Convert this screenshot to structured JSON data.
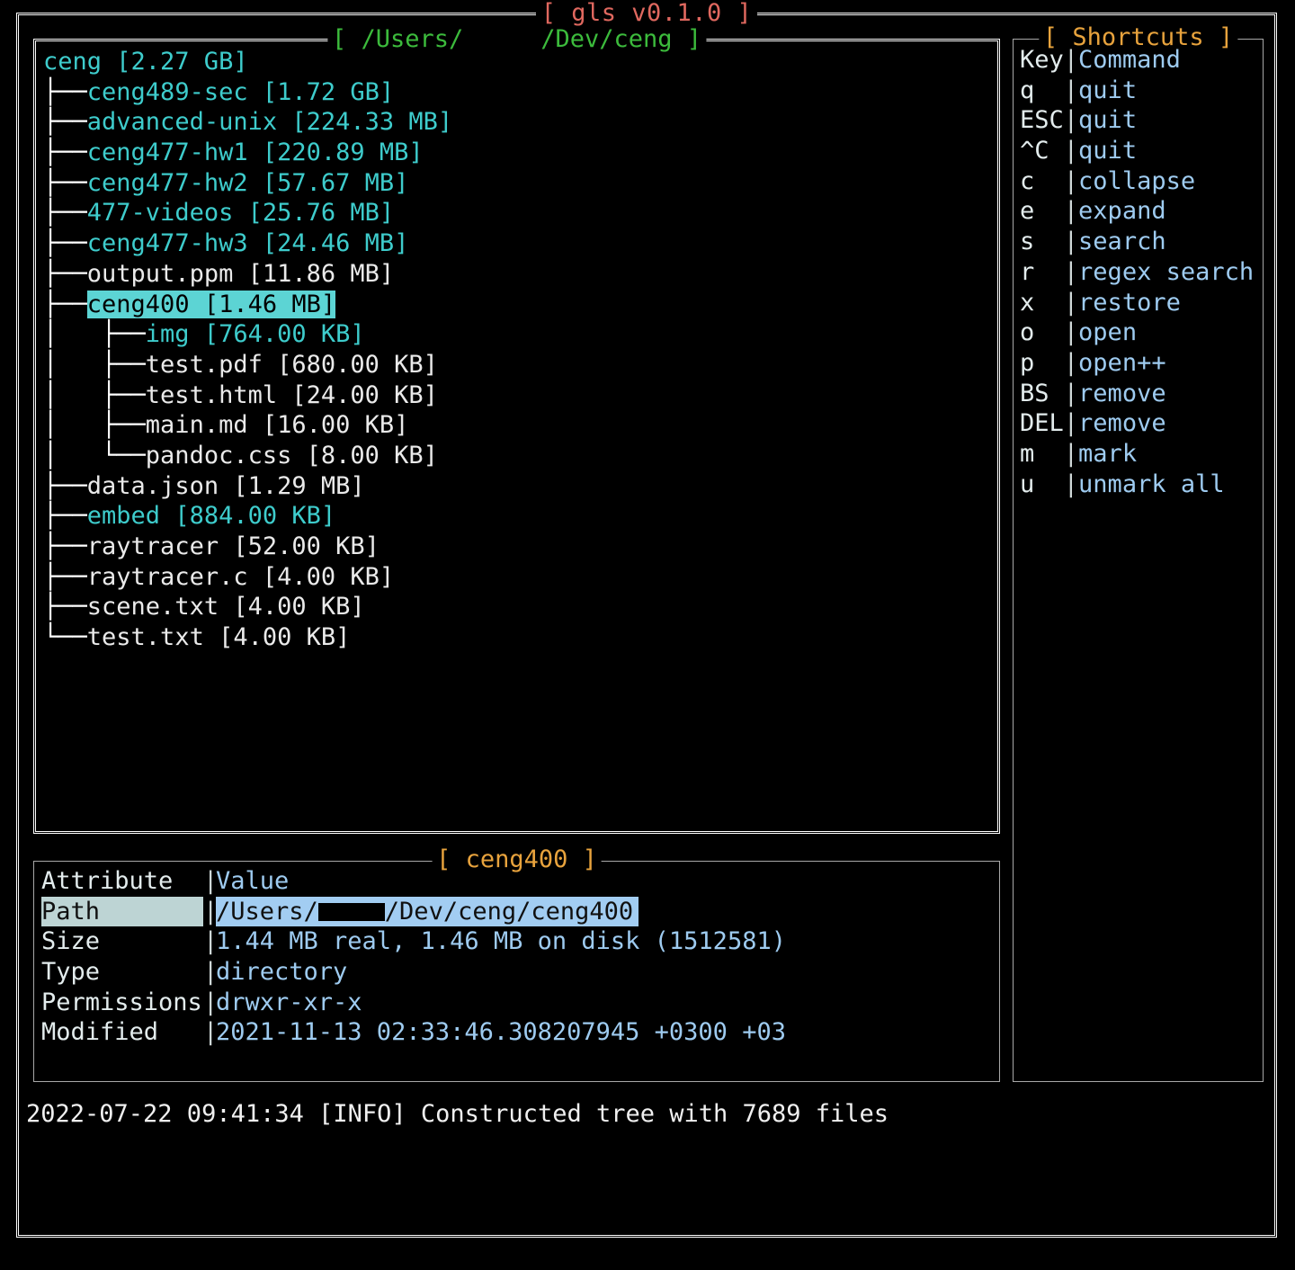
{
  "window": {
    "title": "[ gls v0.1.0 ]",
    "title_color": "#e0685f"
  },
  "tree_panel": {
    "title": "[ /Users/      /Dev/ceng ]",
    "title_prefix": "[ /Users/",
    "title_suffix": "/Dev/ceng ]",
    "title_color": "#3cbb3c",
    "focused": true,
    "rows": [
      {
        "connector": "",
        "name": "ceng",
        "size": "[2.27 GB]",
        "kind": "dir",
        "selected": false
      },
      {
        "connector": "├──",
        "name": "ceng489-sec",
        "size": "[1.72 GB]",
        "kind": "dir",
        "selected": false
      },
      {
        "connector": "├──",
        "name": "advanced-unix",
        "size": "[224.33 MB]",
        "kind": "dir",
        "selected": false
      },
      {
        "connector": "├──",
        "name": "ceng477-hw1",
        "size": "[220.89 MB]",
        "kind": "dir",
        "selected": false
      },
      {
        "connector": "├──",
        "name": "ceng477-hw2",
        "size": "[57.67 MB]",
        "kind": "dir",
        "selected": false
      },
      {
        "connector": "├──",
        "name": "477-videos",
        "size": "[25.76 MB]",
        "kind": "dir",
        "selected": false
      },
      {
        "connector": "├──",
        "name": "ceng477-hw3",
        "size": "[24.46 MB]",
        "kind": "dir",
        "selected": false
      },
      {
        "connector": "├──",
        "name": "output.ppm",
        "size": "[11.86 MB]",
        "kind": "file",
        "selected": false
      },
      {
        "connector": "├──",
        "name": "ceng400",
        "size": "[1.46 MB]",
        "kind": "dir",
        "selected": true
      },
      {
        "connector": "│   ├──",
        "name": "img",
        "size": "[764.00 KB]",
        "kind": "dir",
        "selected": false
      },
      {
        "connector": "│   ├──",
        "name": "test.pdf",
        "size": "[680.00 KB]",
        "kind": "file",
        "selected": false
      },
      {
        "connector": "│   ├──",
        "name": "test.html",
        "size": "[24.00 KB]",
        "kind": "file",
        "selected": false
      },
      {
        "connector": "│   ├──",
        "name": "main.md",
        "size": "[16.00 KB]",
        "kind": "file",
        "selected": false
      },
      {
        "connector": "│   └──",
        "name": "pandoc.css",
        "size": "[8.00 KB]",
        "kind": "file",
        "selected": false
      },
      {
        "connector": "├──",
        "name": "data.json",
        "size": "[1.29 MB]",
        "kind": "file",
        "selected": false
      },
      {
        "connector": "├──",
        "name": "embed",
        "size": "[884.00 KB]",
        "kind": "dir",
        "selected": false
      },
      {
        "connector": "├──",
        "name": "raytracer",
        "size": "[52.00 KB]",
        "kind": "file",
        "selected": false
      },
      {
        "connector": "├──",
        "name": "raytracer.c",
        "size": "[4.00 KB]",
        "kind": "file",
        "selected": false
      },
      {
        "connector": "├──",
        "name": "scene.txt",
        "size": "[4.00 KB]",
        "kind": "file",
        "selected": false
      },
      {
        "connector": "└──",
        "name": "test.txt",
        "size": "[4.00 KB]",
        "kind": "file",
        "selected": false
      }
    ]
  },
  "shortcuts_panel": {
    "title": "[ Shortcuts ]",
    "title_color": "#e8a33d",
    "focused": false,
    "header": {
      "key": "Key",
      "command": "Command"
    },
    "rows": [
      {
        "key": "q",
        "command": "quit"
      },
      {
        "key": "ESC",
        "command": "quit"
      },
      {
        "key": "^C",
        "command": "quit"
      },
      {
        "key": "c",
        "command": "collapse"
      },
      {
        "key": "e",
        "command": "expand"
      },
      {
        "key": "s",
        "command": "search"
      },
      {
        "key": "r",
        "command": "regex search"
      },
      {
        "key": "x",
        "command": "restore"
      },
      {
        "key": "o",
        "command": "open"
      },
      {
        "key": "p",
        "command": "open++"
      },
      {
        "key": "BS",
        "command": "remove"
      },
      {
        "key": "DEL",
        "command": "remove"
      },
      {
        "key": "m",
        "command": "mark"
      },
      {
        "key": "u",
        "command": "unmark all"
      }
    ]
  },
  "details_panel": {
    "title": "[ ceng400 ]",
    "title_color": "#e8a33d",
    "focused": false,
    "header": {
      "attribute": "Attribute",
      "value": "Value"
    },
    "rows": [
      {
        "attribute": "Path",
        "value_prefix": "/Users/",
        "value_suffix": "/Dev/ceng/ceng400",
        "redacted": true,
        "selected": true
      },
      {
        "attribute": "Size",
        "value": "1.44 MB real, 1.46 MB on disk (1512581)",
        "redacted": false,
        "selected": false
      },
      {
        "attribute": "Type",
        "value": "directory",
        "redacted": false,
        "selected": false
      },
      {
        "attribute": "Permissions",
        "value": "drwxr-xr-x",
        "redacted": false,
        "selected": false
      },
      {
        "attribute": "Modified",
        "value": "2021-11-13 02:33:46.308207945 +0300 +03",
        "redacted": false,
        "selected": false
      }
    ]
  },
  "log": {
    "line": "2022-07-22 09:41:34 [INFO] Constructed tree with 7689 files"
  }
}
